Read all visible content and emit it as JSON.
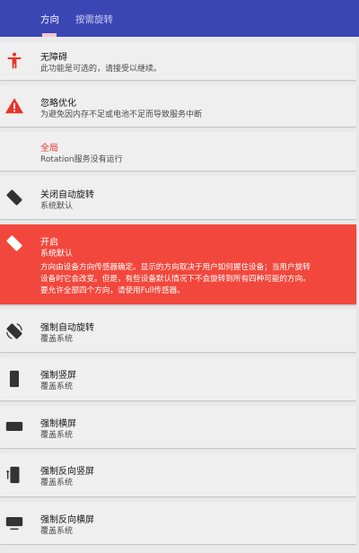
{
  "tabs": [
    {
      "label": "方向",
      "active": true
    },
    {
      "label": "按需旋转",
      "active": false
    }
  ],
  "cards": {
    "accessibility": {
      "title": "无障碍",
      "sub": "此功能是可选的，请接受以继续。",
      "icon": "accessibility-icon"
    },
    "ignore_opt": {
      "title": "忽略优化",
      "sub": "为避免因内存不足或电池不足而导致服务中断",
      "icon": "warning-icon"
    },
    "global": {
      "title": "全局",
      "sub": "Rotation服务没有运行"
    },
    "disable_auto": {
      "title": "关闭自动旋转",
      "sub": "系统默认",
      "icon": "phone-tilted-icon"
    },
    "enabled": {
      "title": "开启",
      "sub": "系统默认",
      "desc": [
        "方向由设备方向传感器确定。显示的方向取决于用户如何握住设备；当用户旋转",
        "设备时它会改变。但是，有些设备默认情况下不会旋转到所有四种可能的方向。",
        "要允许全部四个方向，请使用Full传感器。"
      ],
      "icon": "phone-rotate-icon"
    },
    "force_auto": {
      "title": "强制自动旋转",
      "sub": "覆盖系统",
      "icon": "phone-auto-rotate-icon"
    },
    "force_portrait": {
      "title": "强制竖屏",
      "sub": "覆盖系统",
      "icon": "phone-portrait-icon"
    },
    "force_landscape": {
      "title": "强制横屏",
      "sub": "覆盖系统",
      "icon": "phone-landscape-icon"
    },
    "force_rev_portrait": {
      "title": "强制反向竖屏",
      "sub": "覆盖系统",
      "icon": "phone-reverse-portrait-icon"
    },
    "force_rev_landscape": {
      "title": "强制反向横屏",
      "sub": "覆盖系统",
      "icon": "phone-reverse-landscape-icon"
    }
  },
  "colors": {
    "topbar": "#3b46b5",
    "accent_red": "#f2473c",
    "card": "#efefef",
    "background": "#e9e9e9"
  }
}
